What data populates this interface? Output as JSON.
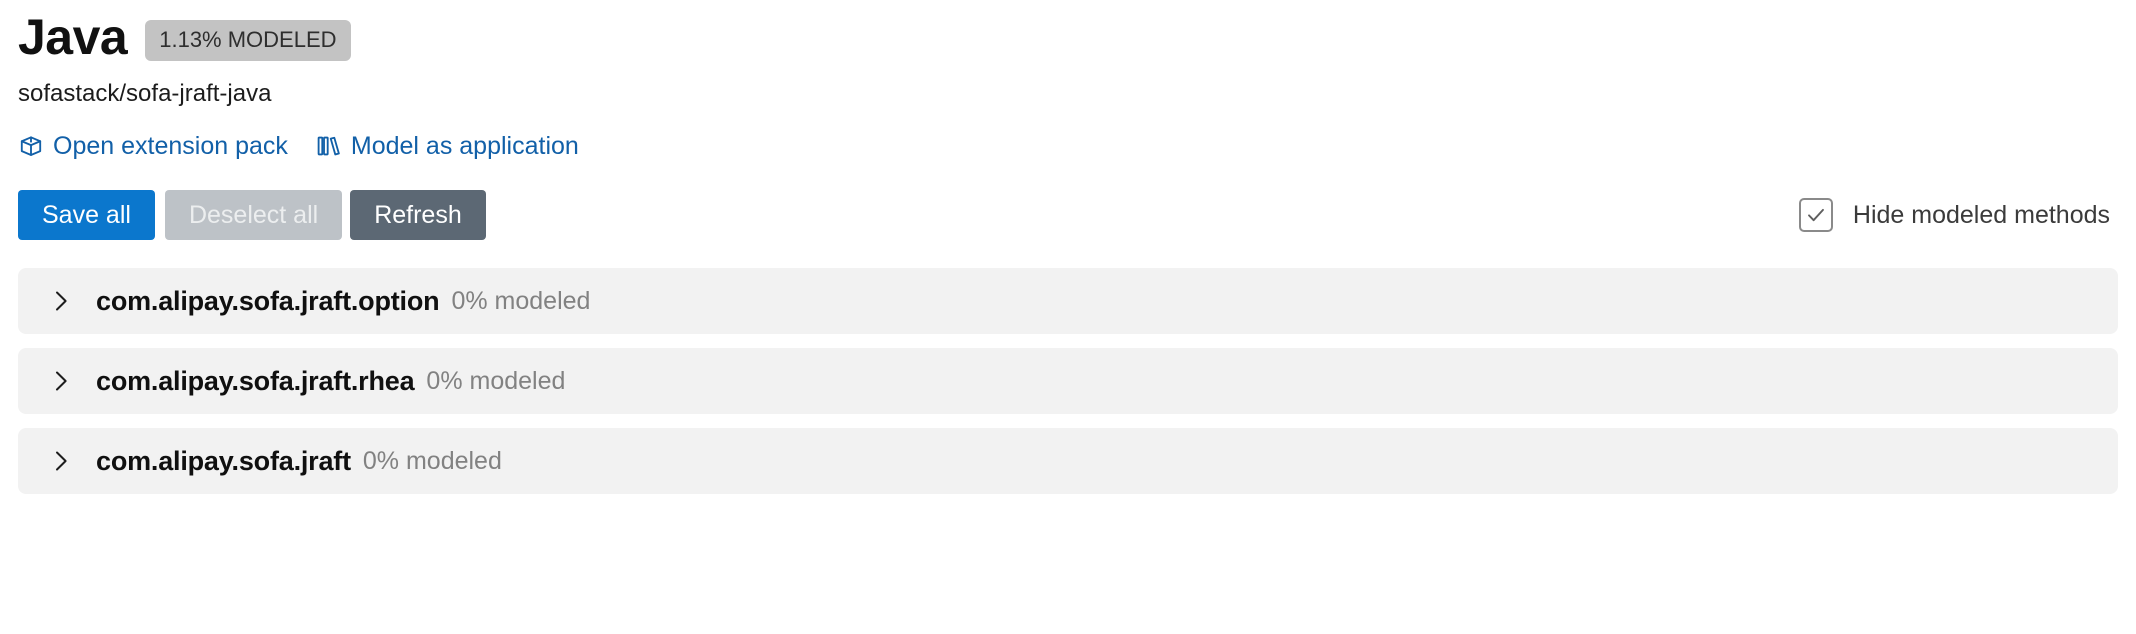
{
  "header": {
    "title": "Java",
    "badge": "1.13% MODELED",
    "repo": "sofastack/sofa-jraft-java"
  },
  "links": [
    {
      "label": "Open extension pack",
      "icon": "package-icon"
    },
    {
      "label": "Model as application",
      "icon": "library-icon"
    }
  ],
  "toolbar": {
    "save_all_label": "Save all",
    "deselect_all_label": "Deselect all",
    "refresh_label": "Refresh",
    "hide_modeled_label": "Hide modeled methods",
    "hide_modeled_checked": true
  },
  "packages": [
    {
      "name": "com.alipay.sofa.jraft.option",
      "modeled": "0% modeled",
      "expanded": false
    },
    {
      "name": "com.alipay.sofa.jraft.rhea",
      "modeled": "0% modeled",
      "expanded": false
    },
    {
      "name": "com.alipay.sofa.jraft",
      "modeled": "0% modeled",
      "expanded": false
    }
  ],
  "colors": {
    "link": "#1260a8",
    "primary_button": "#0b77cd",
    "disabled_button": "#bdc2c7",
    "dark_button": "#5c6874",
    "badge_background": "#c3c3c3",
    "row_background": "#f2f2f2",
    "muted_text": "#828282"
  }
}
